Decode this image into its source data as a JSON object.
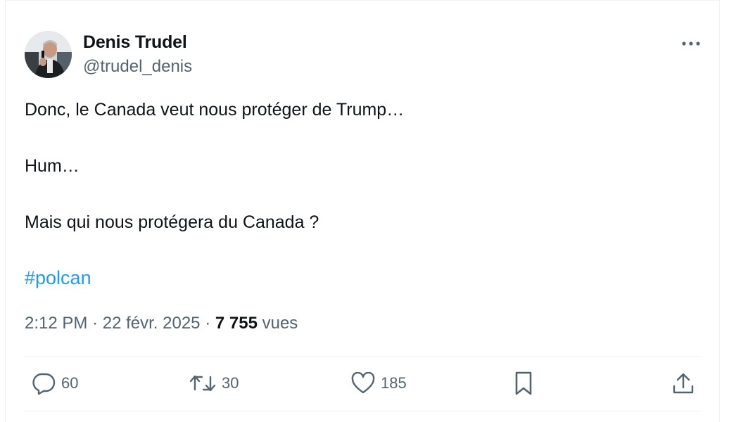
{
  "author": {
    "name": "Denis Trudel",
    "handle": "@trudel_denis"
  },
  "tweet": {
    "lines": [
      "Donc, le Canada veut nous protéger de Trump…",
      "Hum…",
      "Mais qui nous protégera du Canada ?"
    ],
    "hashtag": "#polcan"
  },
  "meta": {
    "time": "2:12 PM",
    "separator": "·",
    "date": "22 févr. 2025",
    "views_count": "7 755",
    "views_label": "vues"
  },
  "actions": {
    "replies": "60",
    "reposts": "30",
    "likes": "185"
  },
  "icons": {
    "more": "more-horizontal-icon",
    "reply": "reply-icon",
    "repost": "repost-icon",
    "like": "heart-icon",
    "bookmark": "bookmark-icon",
    "share": "share-icon"
  },
  "colors": {
    "text": "#0f1419",
    "secondary": "#536471",
    "link": "#1d9bf0",
    "border": "#eff3f4"
  }
}
